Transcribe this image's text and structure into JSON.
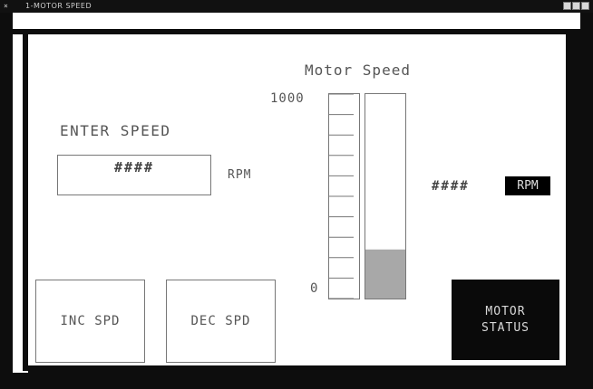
{
  "window": {
    "title": "1-MOTOR SPEED",
    "sysmenu_glyph": "×",
    "controls": [
      "minimize",
      "maximize",
      "close"
    ]
  },
  "gauge": {
    "title": "Motor Speed",
    "scale_max": "1000",
    "scale_min": "0",
    "tick_count": 11,
    "level_fraction": 0.24,
    "fill_color": "#a8a8a8"
  },
  "entry": {
    "label": "ENTER SPEED",
    "value": "####",
    "unit": "RPM"
  },
  "readout": {
    "value": "####",
    "unit": "RPM"
  },
  "buttons": {
    "inc": "INC SPD",
    "dec": "DEC SPD"
  },
  "status": {
    "line1": "MOTOR",
    "line2": "STATUS"
  },
  "colors": {
    "frame": "#0d0d0d",
    "panel": "#ffffff",
    "text": "#555555",
    "status_bg": "#0a0a0a"
  }
}
